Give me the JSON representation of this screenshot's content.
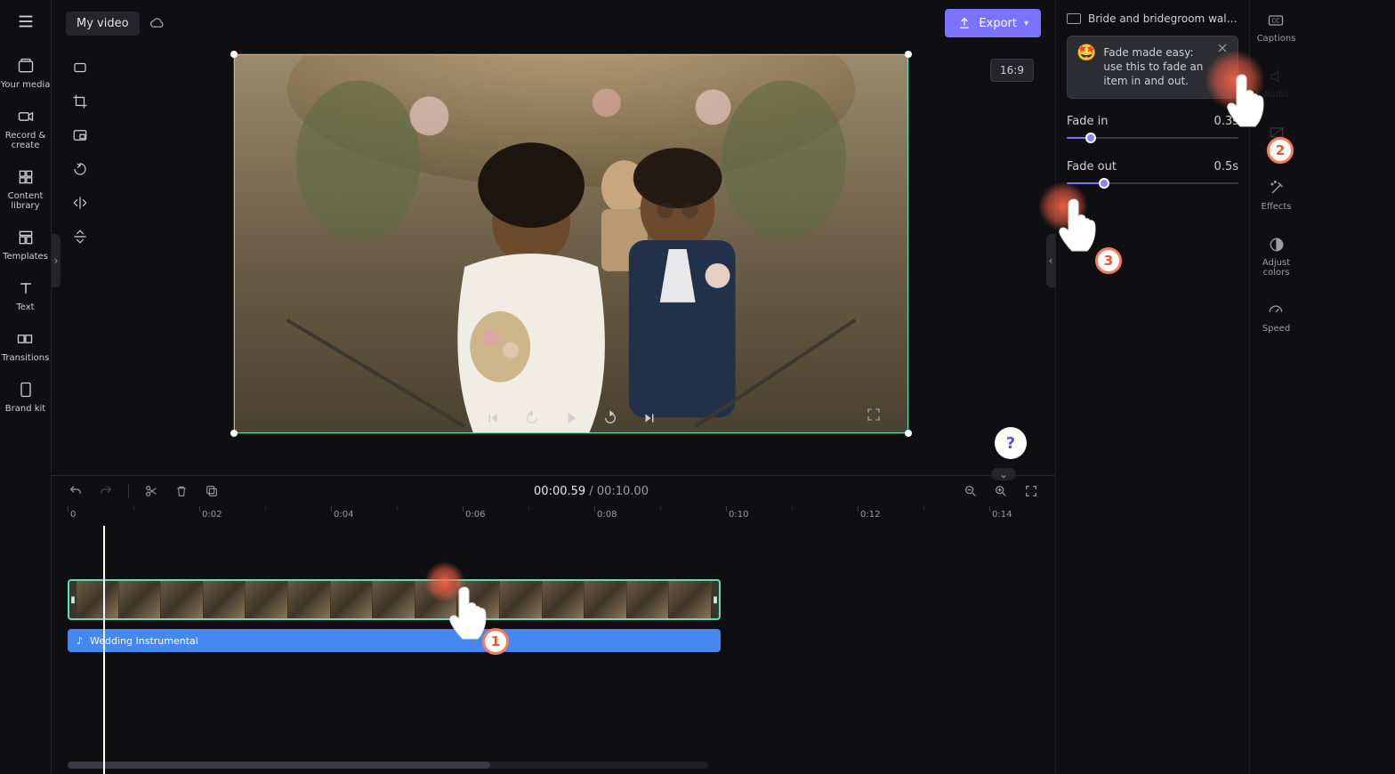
{
  "topbar": {
    "project_title": "My video",
    "export_label": "Export",
    "aspect_label": "16:9"
  },
  "left_rail": [
    {
      "label": "Your media"
    },
    {
      "label": "Record & create"
    },
    {
      "label": "Content library"
    },
    {
      "label": "Templates"
    },
    {
      "label": "Text"
    },
    {
      "label": "Transitions"
    },
    {
      "label": "Brand kit"
    }
  ],
  "transport": {
    "current": "00:00.59",
    "separator": " / ",
    "total": "00:10.00"
  },
  "ruler": [
    "0",
    "0:02",
    "0:04",
    "0:06",
    "0:08",
    "0:10",
    "0:12",
    "0:14"
  ],
  "tracks": {
    "audio_label": "Wedding Instrumental"
  },
  "inspector": {
    "clip_title": "Bride and bridegroom walking t…",
    "tip_text": "Fade made easy: use this to fade an item in and out.",
    "tip_emoji": "🤩",
    "fade_in_label": "Fade in",
    "fade_in_value": "0.3s",
    "fade_in_percent": 14,
    "fade_out_label": "Fade out",
    "fade_out_value": "0.5s",
    "fade_out_percent": 22
  },
  "right_rail": [
    {
      "label": "Captions"
    },
    {
      "label": "Audio"
    },
    {
      "label": "Fade",
      "active": true
    },
    {
      "label": "Effects"
    },
    {
      "label": "Adjust colors"
    },
    {
      "label": "Speed"
    }
  ],
  "pointers": {
    "p1": "1",
    "p2": "2",
    "p3": "3"
  },
  "colors": {
    "accent": "#7b73ff",
    "clip_border": "#5ce0b8",
    "audio": "#4688f1",
    "pointer": "#ff7a59"
  }
}
